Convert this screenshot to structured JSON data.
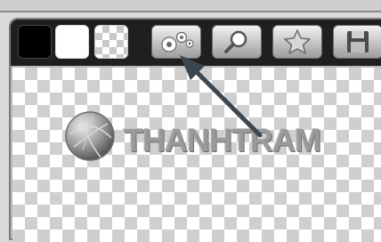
{
  "toolbar": {
    "swatches": [
      {
        "name": "black",
        "color": "#000000"
      },
      {
        "name": "white",
        "color": "#ffffff"
      },
      {
        "name": "transparent",
        "color": "checkerboard"
      }
    ],
    "tools": [
      {
        "icon": "gears-icon"
      },
      {
        "icon": "magnifier-icon"
      },
      {
        "icon": "star-icon"
      },
      {
        "icon": "floppy-disk-icon"
      }
    ]
  },
  "canvas": {
    "logo_text": "THANHTRAM"
  },
  "colors": {
    "toolbar_bg": "#1f1f1f",
    "logo_text": "#9a9a9a",
    "arrow": "#3c4650"
  }
}
